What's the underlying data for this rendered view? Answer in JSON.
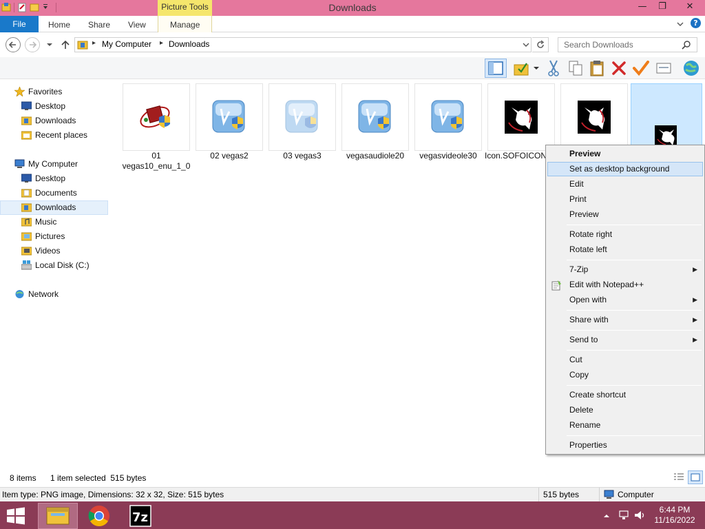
{
  "window": {
    "title": "Downloads",
    "contextual_tab_group": "Picture Tools",
    "controls": {
      "minimize": "—",
      "restore": "❐",
      "close": "✕"
    }
  },
  "ribbon": {
    "tabs": [
      "File",
      "Home",
      "Share",
      "View",
      "Manage"
    ],
    "help": "?"
  },
  "address": {
    "path": [
      "My Computer",
      "Downloads"
    ],
    "search_placeholder": "Search Downloads"
  },
  "nav": {
    "favorites_label": "Favorites",
    "favorites": [
      "Desktop",
      "Downloads",
      "Recent places"
    ],
    "computer_label": "My Computer",
    "computer": [
      "Desktop",
      "Documents",
      "Downloads",
      "Music",
      "Pictures",
      "Videos",
      "Local Disk (C:)"
    ],
    "network_label": "Network",
    "selected": "Downloads"
  },
  "files": [
    {
      "line1": "01",
      "line2": "vegas10_enu_1_0",
      "icon": "installer-box-icon"
    },
    {
      "line1": "02 vegas2",
      "line2": "",
      "icon": "vegas-setup-icon"
    },
    {
      "line1": "03 vegas3",
      "line2": "",
      "icon": "vegas-setup-faded-icon"
    },
    {
      "line1": "vegasaudiole20",
      "line2": "",
      "icon": "vegas-setup-icon"
    },
    {
      "line1": "vegasvideole30",
      "line2": "",
      "icon": "vegas-setup-icon"
    },
    {
      "line1": "Icon.SOFOICON",
      "line2": "",
      "icon": "image-thumbnail-icon"
    },
    {
      "line1": "",
      "line2": "",
      "icon": "image-thumbnail-icon"
    },
    {
      "line1": "",
      "line2": "",
      "icon": "image-thumbnail-icon",
      "selected": true
    }
  ],
  "context_menu": {
    "items": [
      {
        "label": "Preview",
        "bold": true
      },
      {
        "label": "Set as desktop background",
        "highlighted": true
      },
      {
        "label": "Edit"
      },
      {
        "label": "Print"
      },
      {
        "label": "Preview"
      },
      {
        "label": "Rotate right"
      },
      {
        "label": "Rotate left"
      },
      {
        "label": "7-Zip",
        "submenu": true
      },
      {
        "label": "Edit with Notepad++",
        "icon": "notepad-plus-plus-icon"
      },
      {
        "label": "Open with",
        "submenu": true
      },
      {
        "label": "Share with",
        "submenu": true
      },
      {
        "label": "Send to",
        "submenu": true
      },
      {
        "label": "Cut"
      },
      {
        "label": "Copy"
      },
      {
        "label": "Create shortcut"
      },
      {
        "label": "Delete"
      },
      {
        "label": "Rename"
      },
      {
        "label": "Properties"
      }
    ]
  },
  "status": {
    "item_count": "8 items",
    "selection": "1 item selected  515 bytes",
    "details": "Item type: PNG image, Dimensions: 32 x 32, Size: 515 bytes",
    "size": "515 bytes",
    "location": "Computer"
  },
  "taskbar": {
    "time": "6:44 PM",
    "date": "11/16/2022"
  },
  "colors": {
    "title_bar": "#e5779d",
    "contextual_tab": "#f5e66c",
    "file_tab": "#1979ca",
    "taskbar": "#8b3b56",
    "selection": "#cde8ff"
  }
}
